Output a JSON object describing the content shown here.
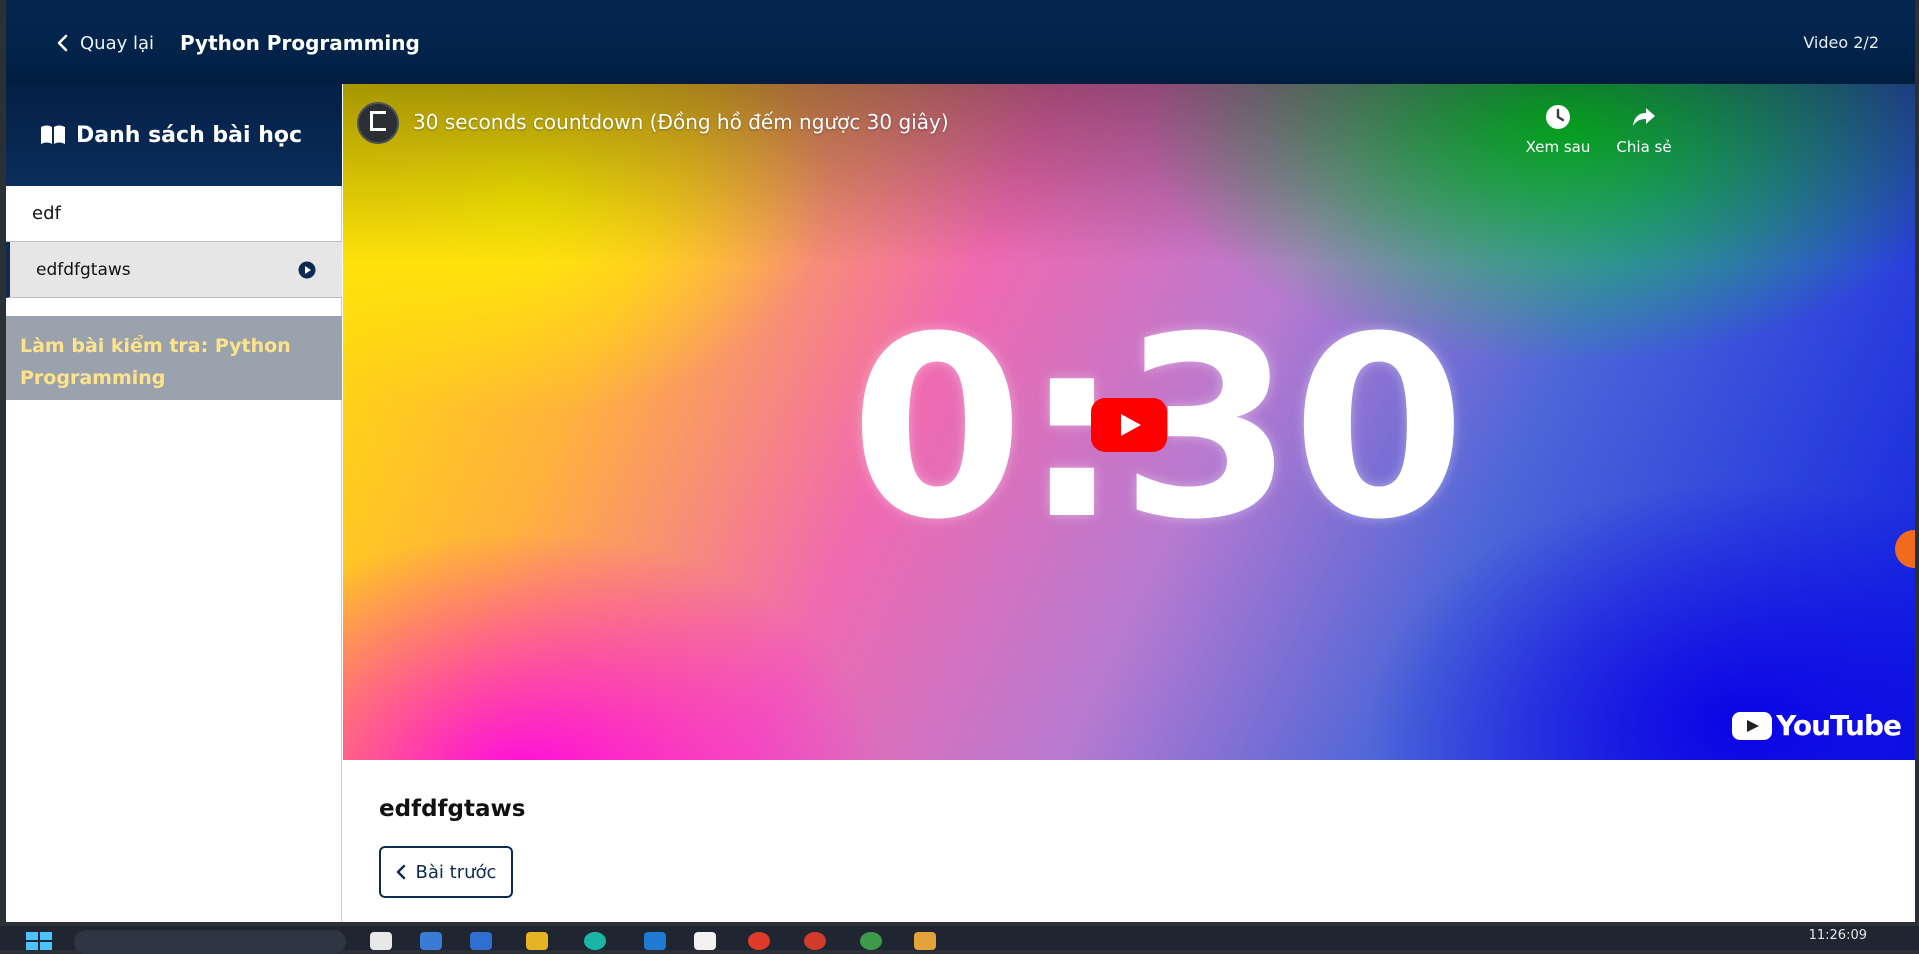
{
  "header": {
    "back_label": "Quay lại",
    "course_title": "Python Programming",
    "video_counter": "Video 2/2"
  },
  "sidebar": {
    "title": "Danh sách bài học",
    "section_label": "edf",
    "lessons": [
      {
        "label": "edfdfgtaws",
        "active": true
      }
    ],
    "quiz_label": "Làm bài kiểm tra: Python Programming"
  },
  "video": {
    "title": "30 seconds countdown (Đồng hồ đếm ngược 30 giây)",
    "countdown_text": "0:30",
    "watch_later_label": "Xem sau",
    "share_label": "Chia sẻ",
    "logo_text": "YouTube"
  },
  "main": {
    "lesson_heading": "edfdfgtaws",
    "prev_button_label": "Bài trước"
  },
  "taskbar": {
    "clock": "11:26:09"
  },
  "colors": {
    "header_bg": "#02234a",
    "accent": "#0d2a52",
    "quiz_bg": "#9aa3ad",
    "quiz_text": "#ffe38a",
    "play_red": "#ff0000"
  }
}
